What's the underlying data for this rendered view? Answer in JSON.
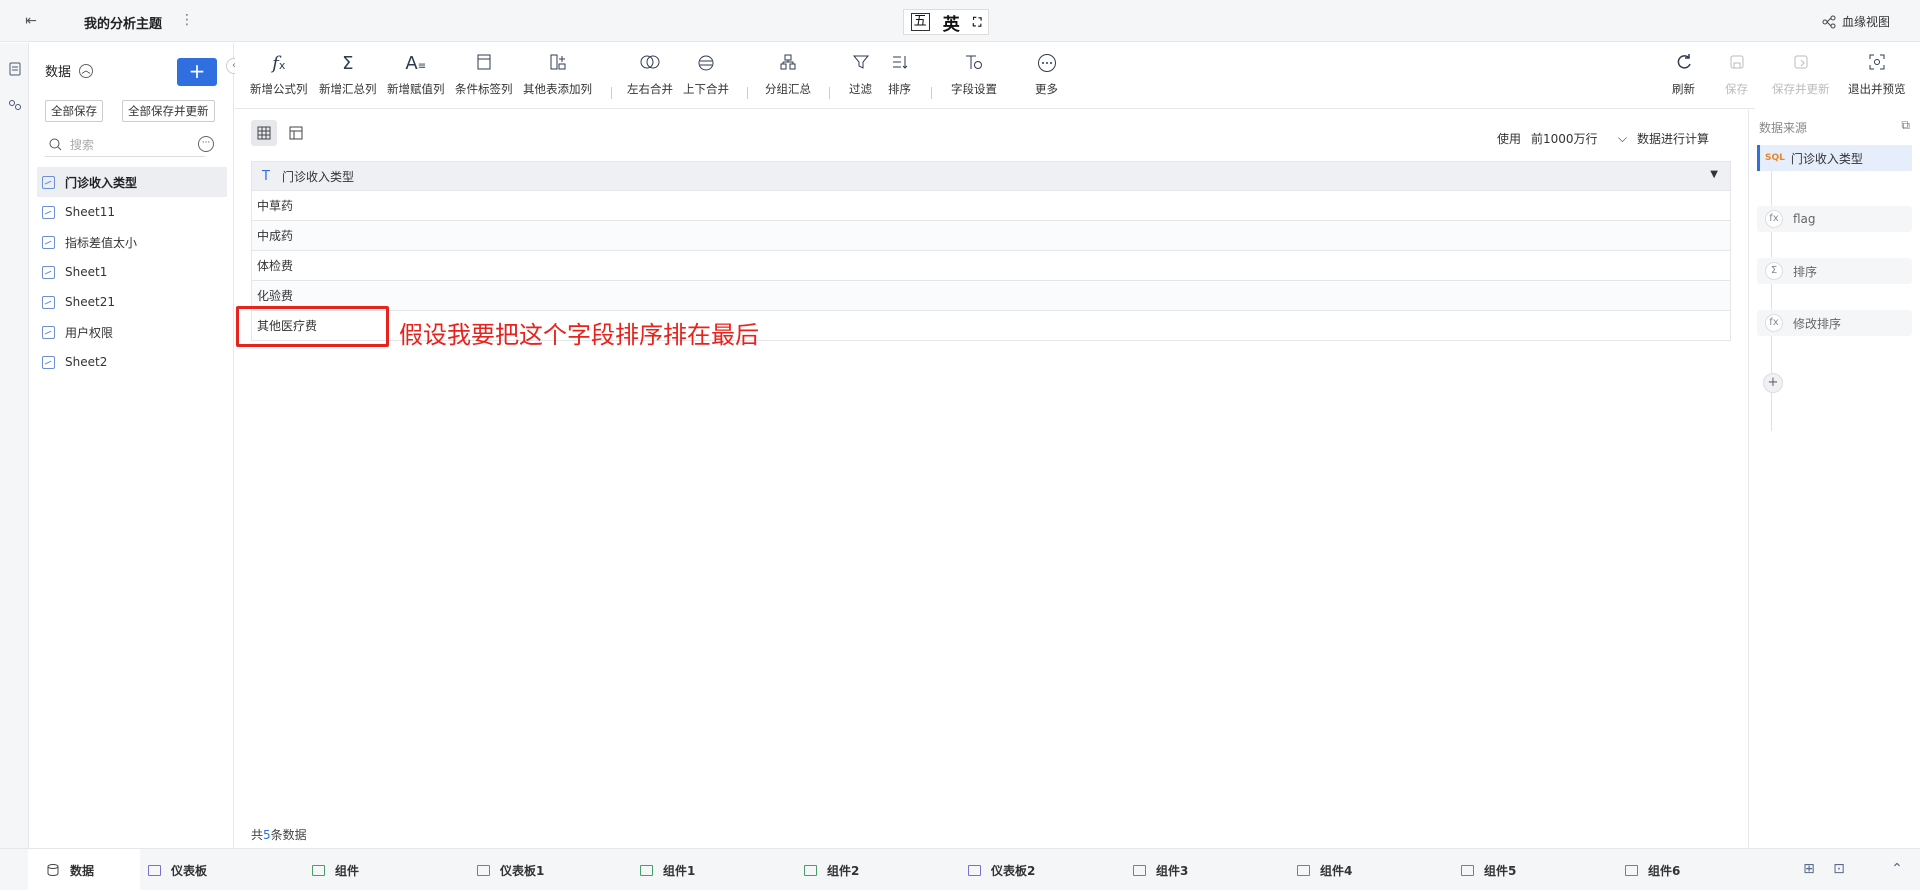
{
  "topbar": {
    "title": "我的分析主题",
    "ime_box": "五",
    "ime_lang": "英",
    "lineage": "血缘视图"
  },
  "sidebar": {
    "header": "数据",
    "save_all": "全部保存",
    "save_all_update": "全部保存并更新",
    "search_placeholder": "搜索",
    "sheets": [
      {
        "label": "门诊收入类型",
        "active": true
      },
      {
        "label": "Sheet11"
      },
      {
        "label": "指标差值太小"
      },
      {
        "label": "Sheet1"
      },
      {
        "label": "Sheet21"
      },
      {
        "label": "用户权限"
      },
      {
        "label": "Sheet2"
      }
    ]
  },
  "toolbar": {
    "items": [
      {
        "label": "新增公式列",
        "icon": "fx-icon"
      },
      {
        "label": "新增汇总列",
        "icon": "sigma-icon"
      },
      {
        "label": "新增赋值列",
        "icon": "assign-icon"
      },
      {
        "label": "条件标签列",
        "icon": "tag-icon"
      },
      {
        "label": "其他表添加列",
        "icon": "add-column-icon"
      },
      {
        "label": "左右合并",
        "icon": "merge-lr-icon"
      },
      {
        "label": "上下合并",
        "icon": "merge-tb-icon"
      },
      {
        "label": "分组汇总",
        "icon": "group-icon"
      },
      {
        "label": "过滤",
        "icon": "filter-icon"
      },
      {
        "label": "排序",
        "icon": "sort-icon"
      },
      {
        "label": "字段设置",
        "icon": "field-settings-icon"
      },
      {
        "label": "更多",
        "icon": "more-icon"
      }
    ],
    "right_items": [
      {
        "label": "刷新",
        "icon": "refresh-icon"
      },
      {
        "label": "保存",
        "icon": "save-icon",
        "disabled": true
      },
      {
        "label": "保存并更新",
        "icon": "save-update-icon",
        "disabled": true
      },
      {
        "label": "退出并预览",
        "icon": "exit-preview-icon"
      }
    ]
  },
  "main": {
    "use_label": "使用",
    "rows_option": "前1000万行",
    "calc_label": "数据进行计算",
    "column_header": "门诊收入类型",
    "rows": [
      "中草药",
      "中成药",
      "体检费",
      "化验费",
      "其他医疗费"
    ],
    "annotation": "假设我要把这个字段排序排在最后",
    "count_prefix": "共",
    "count": "5",
    "count_suffix": "条数据"
  },
  "right_panel": {
    "title": "数据来源",
    "source": "门诊收入类型",
    "sql_tag": "SQL",
    "steps": [
      {
        "label": "flag",
        "icon": "fx-icon"
      },
      {
        "label": "排序",
        "icon": "sigma-icon"
      },
      {
        "label": "修改排序",
        "icon": "fx-icon"
      }
    ]
  },
  "bottom_tabs": [
    {
      "label": "数据",
      "active": true
    },
    {
      "label": "仪表板"
    },
    {
      "label": "组件"
    },
    {
      "label": "仪表板1"
    },
    {
      "label": "组件1"
    },
    {
      "label": "组件2"
    },
    {
      "label": "仪表板2"
    },
    {
      "label": "组件3"
    },
    {
      "label": "组件4"
    },
    {
      "label": "组件5"
    },
    {
      "label": "组件6"
    }
  ],
  "colors": {
    "accent": "#2f6fe0",
    "annotation": "#e8221c",
    "bar_bg": "#f5f6f8"
  }
}
